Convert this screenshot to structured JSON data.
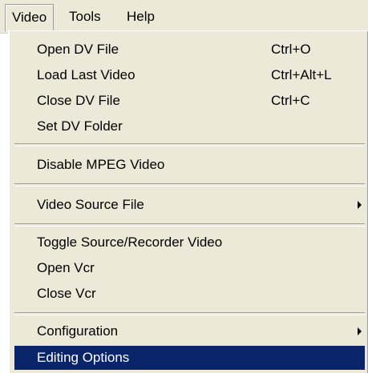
{
  "menubar": {
    "items": [
      {
        "label": "Video",
        "active": true
      },
      {
        "label": "Tools",
        "active": false
      },
      {
        "label": "Help",
        "active": false
      }
    ]
  },
  "menu": {
    "highlight_color": "#0a246a",
    "items": [
      {
        "label": "Open DV File",
        "shortcut": "Ctrl+O"
      },
      {
        "label": "Load Last Video",
        "shortcut": "Ctrl+Alt+L"
      },
      {
        "label": "Close DV File",
        "shortcut": "Ctrl+C"
      },
      {
        "label": "Set DV Folder",
        "shortcut": ""
      },
      {
        "label": "Disable MPEG Video",
        "shortcut": ""
      },
      {
        "label": "Video Source File",
        "shortcut": "",
        "submenu": true
      },
      {
        "label": "Toggle Source/Recorder Video",
        "shortcut": ""
      },
      {
        "label": "Open Vcr",
        "shortcut": ""
      },
      {
        "label": "Close Vcr",
        "shortcut": ""
      },
      {
        "label": "Configuration",
        "shortcut": "",
        "submenu": true
      },
      {
        "label": "Editing Options",
        "shortcut": "",
        "highlighted": true
      }
    ]
  }
}
